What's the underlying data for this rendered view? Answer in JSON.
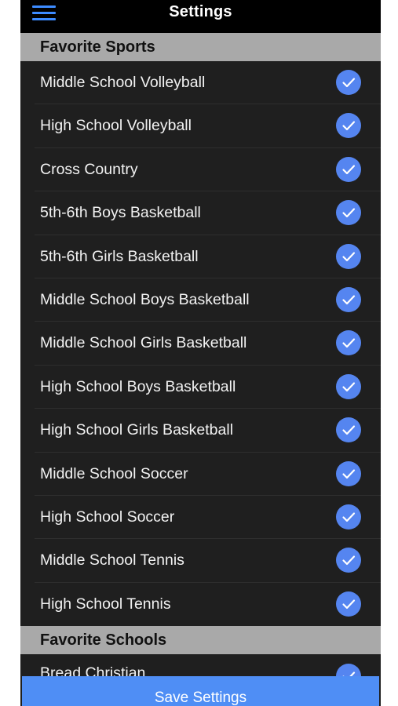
{
  "header": {
    "title": "Settings",
    "menu_icon": "hamburger-menu-icon"
  },
  "sections": {
    "sports_title": "Favorite Sports",
    "schools_title": "Favorite Schools"
  },
  "sports": [
    {
      "label": "Middle School Volleyball",
      "checked": true
    },
    {
      "label": "High School Volleyball",
      "checked": true
    },
    {
      "label": "Cross Country",
      "checked": true
    },
    {
      "label": "5th-6th Boys Basketball",
      "checked": true
    },
    {
      "label": "5th-6th Girls Basketball",
      "checked": true
    },
    {
      "label": "Middle School Boys Basketball",
      "checked": true
    },
    {
      "label": "Middle School Girls Basketball",
      "checked": true
    },
    {
      "label": "High School Boys Basketball",
      "checked": true
    },
    {
      "label": "High School Girls Basketball",
      "checked": true
    },
    {
      "label": "Middle School Soccer",
      "checked": true
    },
    {
      "label": "High School Soccer",
      "checked": true
    },
    {
      "label": "Middle School Tennis",
      "checked": true
    },
    {
      "label": "High School Tennis",
      "checked": true
    }
  ],
  "schools": [
    {
      "label": "Bread Christian",
      "checked": true
    }
  ],
  "footer": {
    "save_label": "Save Settings"
  },
  "colors": {
    "accent": "#5585f0",
    "menu_icon": "#3d8bff",
    "background": "#1f1f1f",
    "section_header": "#a9a9a9",
    "save_button": "#4f8ef5"
  }
}
